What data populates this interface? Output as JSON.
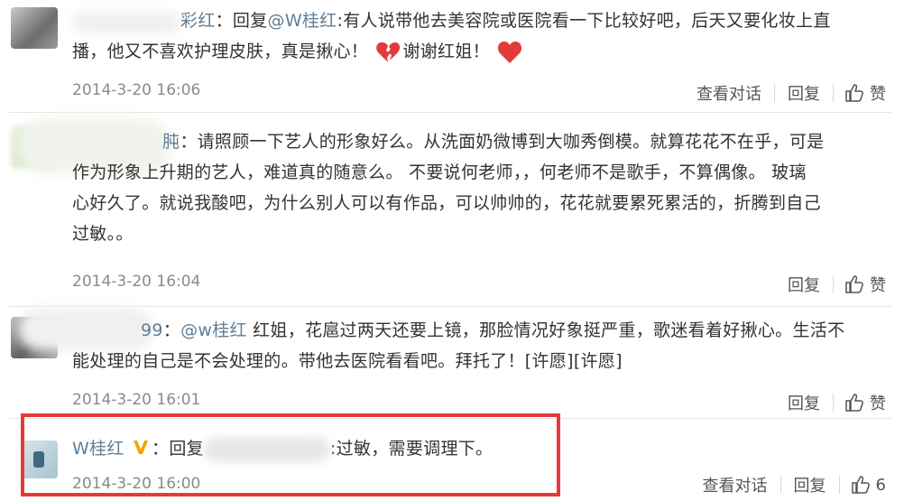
{
  "comments": [
    {
      "username": "彩红",
      "text_prefix": "：回复",
      "mention": "@W桂红",
      "body1": ":有人说带他去美容院或医院看一下比较好吧，后天又要化妆上直",
      "body2": "播，他又不喜欢护理皮肤，真是揪心！",
      "body3": "谢谢红姐！",
      "timestamp": "2014-3-20 16:06",
      "actions": [
        "查看对话",
        "回复",
        "赞"
      ]
    },
    {
      "username": "肫",
      "body1": "：请照顾一下艺人的形象好么。从洗面奶微博到大咖秀倒模。就算花花不在乎，可是",
      "body2": "作为形象上升期的艺人，难道真的随意么。 不要说何老师，，何老师不是歌手，不算偶像。 玻璃",
      "body3": "心好久了。就说我酸吧，为什么别人可以有作品，可以帅帅的，花花就要累死累活的，折腾到自己",
      "body4": "过敏。。",
      "timestamp": "2014-3-20 16:04",
      "actions": [
        "回复",
        "赞"
      ]
    },
    {
      "username": "99",
      "text_prefix": "：",
      "mention": "@w桂红",
      "body1": " 红姐，花扈过两天还要上镜，那脸情况好象挺严重，歌迷看着好揪心。生活不",
      "body2": "能处理的自己是不会处理的。带他去医院看看吧。拜托了！[许愿][许愿]",
      "timestamp": "2014-3-20 16:01",
      "actions": [
        "回复",
        "赞"
      ]
    },
    {
      "username": "W桂红",
      "text_prefix": "：回复",
      "body1": ":过敏，需要调理下。",
      "timestamp": "2014-3-20 16:00",
      "actions": [
        "查看对话",
        "回复"
      ],
      "likes": "6"
    }
  ],
  "icons": {
    "like": "thumbs-up-icon",
    "broken_heart": "broken-heart-icon",
    "heart": "heart-icon",
    "verified": "verified-v-icon"
  },
  "colors": {
    "username": "#5f7e97",
    "highlight_border": "#e43a3a"
  }
}
